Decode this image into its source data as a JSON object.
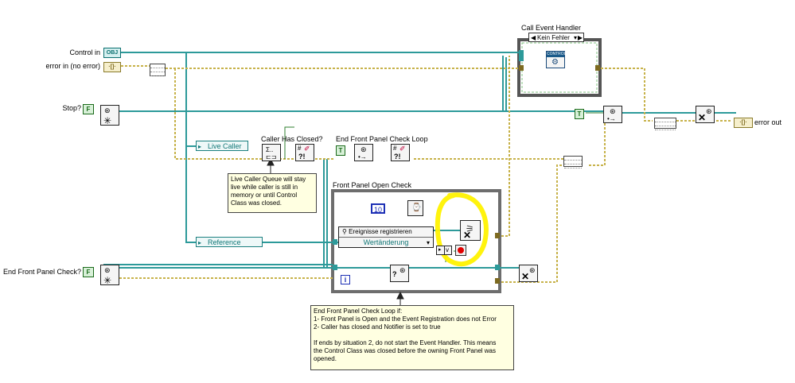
{
  "inputs": {
    "control_in": {
      "label": "Control in",
      "type_tag": "OBJ"
    },
    "error_in": {
      "label": "error in (no error)",
      "type_tag": "·[]·"
    },
    "stop": {
      "label": "Stop?",
      "value": "F"
    },
    "end_fp_check": {
      "label": "End Front Panel Check?",
      "value": "F"
    }
  },
  "outputs": {
    "error_out": {
      "label": "error out",
      "type_tag": "·[]·"
    }
  },
  "call_event_handler": {
    "title": "Call Event Handler",
    "case_selector": "Kein Fehler",
    "control_tag": "CONTROL"
  },
  "nodes": {
    "live_caller": "Live Caller",
    "caller_has_closed": "Caller Has Closed?",
    "end_fp_check_loop": "End Front Panel Check Loop",
    "reference": "Reference",
    "true_constant": "T"
  },
  "fp_open_check": {
    "title": "Front Panel Open Check",
    "timeout": "10",
    "event_reg_label": "Ereignisse registrieren",
    "event_label": "Wertänderung",
    "iteration": "i",
    "condition_v": "v"
  },
  "comments": {
    "live_caller": [
      "Live Caller Queue will stay",
      "live while caller is still in",
      "memory or until Control",
      "Class was closed."
    ],
    "loop_end": [
      "End Front Panel Check Loop if:",
      "1- Front Panel is Open and the Event Registration does not Error",
      "2- Caller has closed and Notifier is set to true",
      "",
      "If ends by situation 2, do not start the Event Handler.  This means",
      "the Control Class was closed before the owning Front Panel was",
      "opened."
    ]
  },
  "colors": {
    "class_wire": "#2d9a9a",
    "error_wire": "#c7b24a",
    "bool_wire": "#2f7f2f",
    "ref_wire": "#2d9a9a",
    "highlight": "#fff200"
  }
}
